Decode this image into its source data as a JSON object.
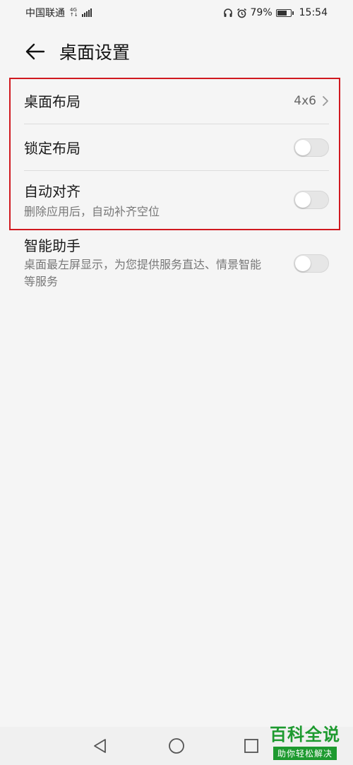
{
  "status_bar": {
    "carrier": "中国联通",
    "network_top": "4G",
    "network_bottom": "↑↓",
    "battery_percent": "79%",
    "battery_level": 0.79,
    "time": "15:54"
  },
  "header": {
    "title": "桌面设置"
  },
  "settings": [
    {
      "title": "桌面布局",
      "value": "4x6"
    },
    {
      "title": "锁定布局",
      "toggle_on": false
    },
    {
      "title": "自动对齐",
      "subtitle": "删除应用后，自动补齐空位",
      "toggle_on": false
    },
    {
      "title": "智能助手",
      "subtitle": "桌面最左屏显示，为您提供服务直达、情景智能等服务",
      "toggle_on": false
    }
  ],
  "highlight_color": "#d0191f",
  "watermark": {
    "title": "百科全说",
    "subtitle": "助你轻松解决"
  }
}
